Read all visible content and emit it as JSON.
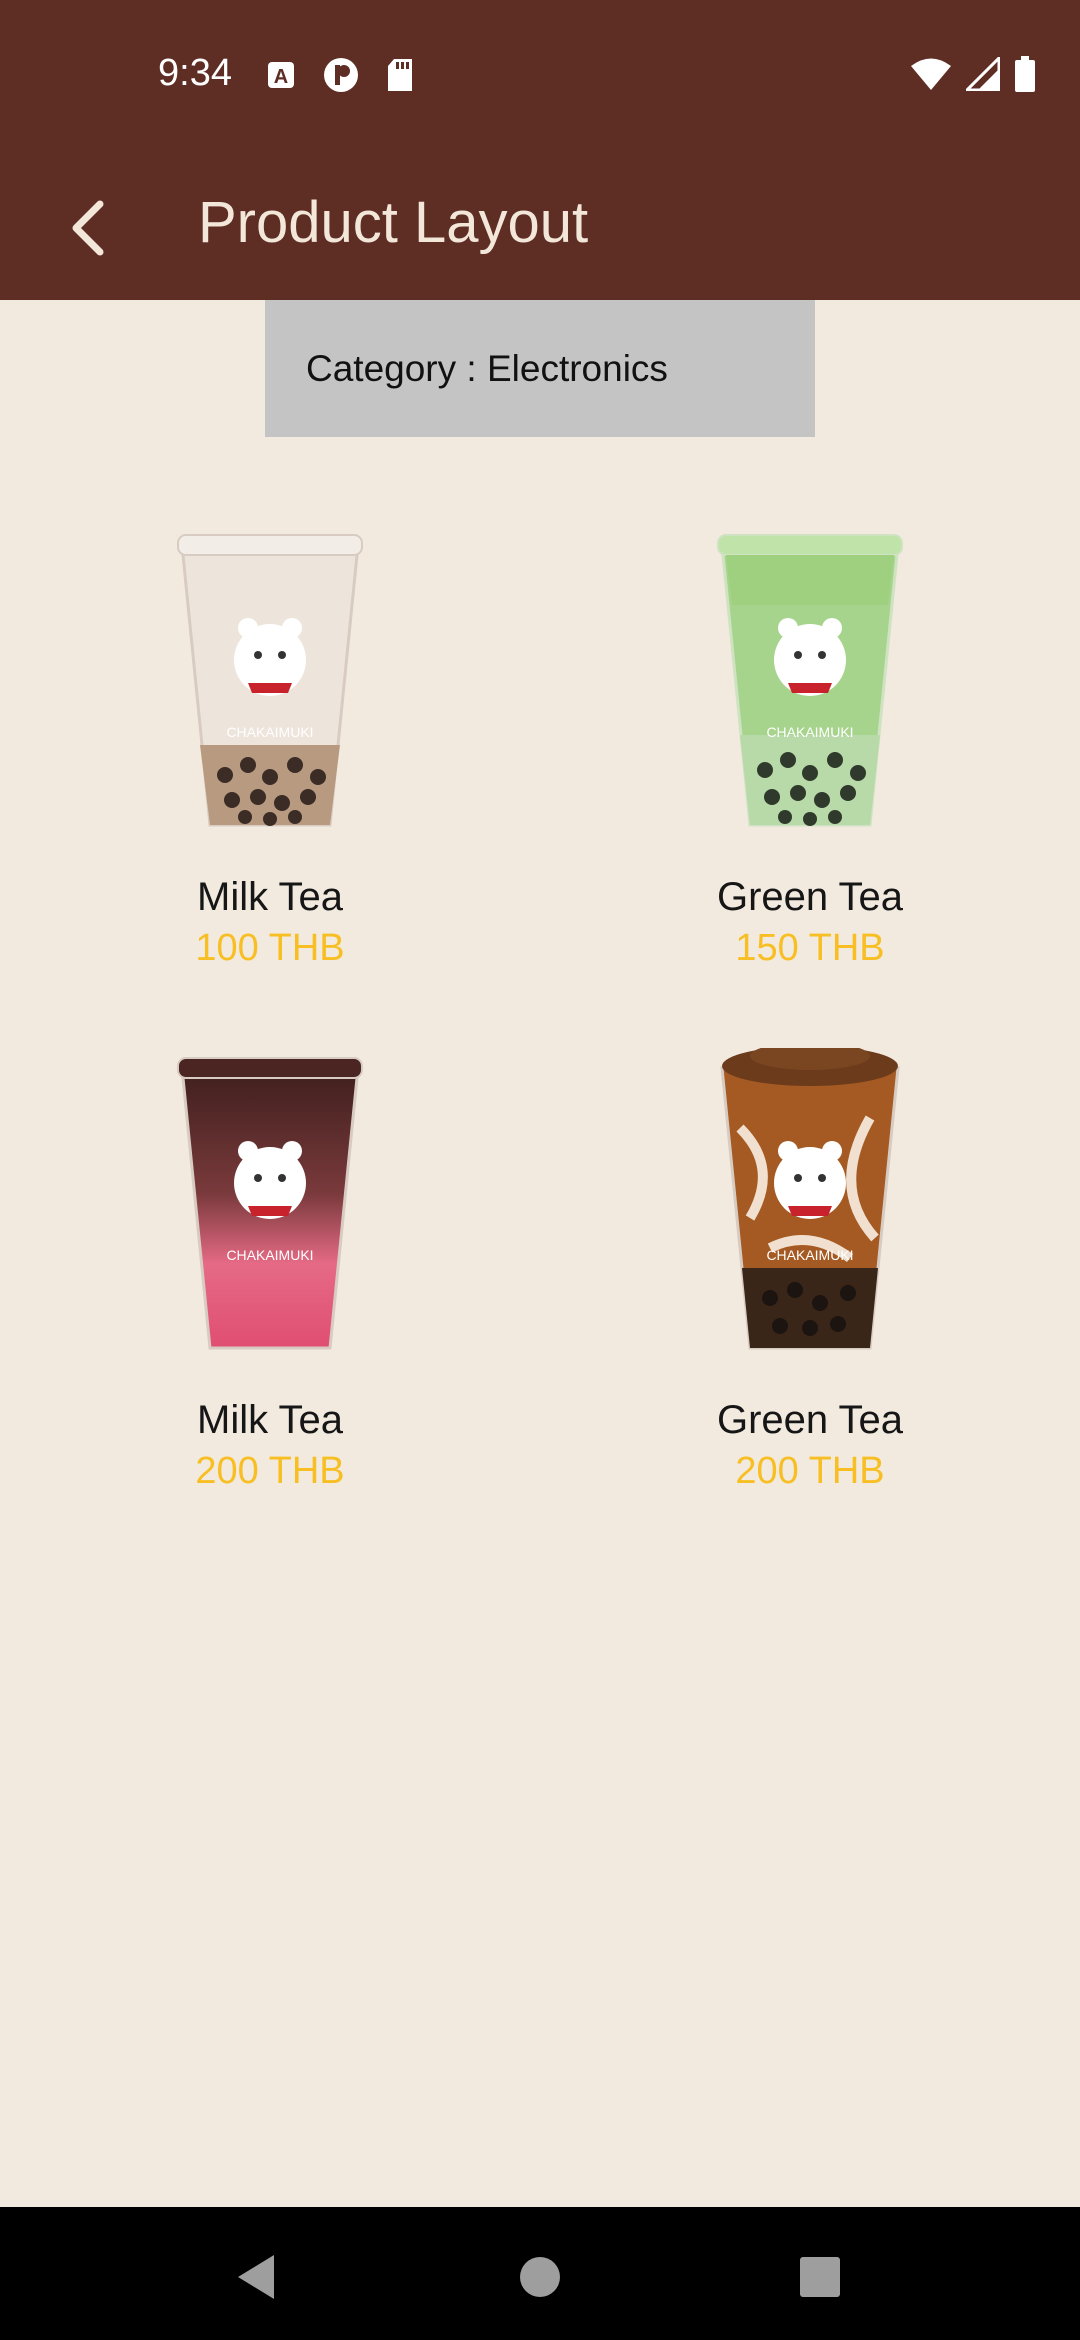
{
  "status_bar": {
    "time": "9:34",
    "left_icons": [
      "text-a-icon",
      "circle-p-icon",
      "sd-card-icon"
    ],
    "right_icons": [
      "wifi-icon",
      "signal-icon",
      "battery-icon"
    ]
  },
  "app_bar": {
    "title": "Product Layout",
    "back_icon": "back-arrow-icon",
    "color": "#5e2d24"
  },
  "category": {
    "label": "Category : Electronics"
  },
  "products": [
    {
      "name": "Milk Tea",
      "price": "100 THB",
      "image": "milk-tea-cup-image"
    },
    {
      "name": "Green Tea",
      "price": "150 THB",
      "image": "green-tea-cup-image"
    },
    {
      "name": "Milk Tea",
      "price": "200 THB",
      "image": "pink-milk-tea-cup-image"
    },
    {
      "name": "Green Tea",
      "price": "200 THB",
      "image": "brown-sugar-tea-cup-image"
    }
  ],
  "colors": {
    "background": "#f3eadf",
    "price": "#f7bf23",
    "category_box": "#c4c4c4"
  },
  "nav_bar": {
    "buttons": [
      "back-triangle-icon",
      "home-circle-icon",
      "recents-square-icon"
    ]
  }
}
